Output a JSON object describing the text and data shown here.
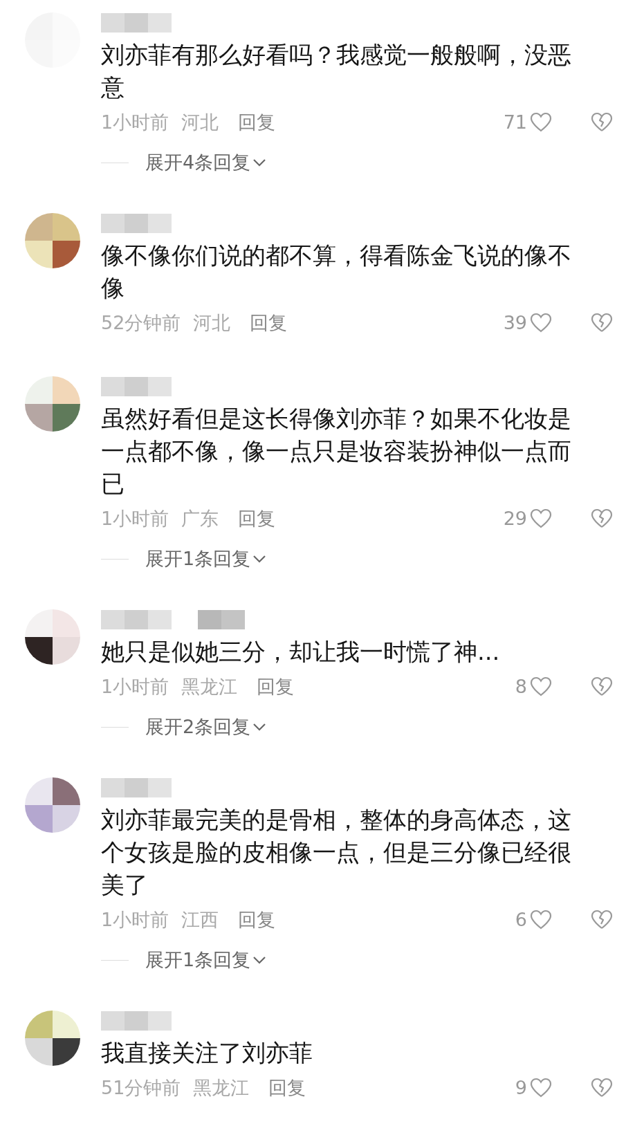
{
  "comments": [
    {
      "text": "刘亦菲有那么好看吗？我感觉一般般啊，没恶意",
      "time": "1小时前",
      "region": "河北",
      "reply": "回复",
      "likes": "71",
      "expand": "展开4条回复"
    },
    {
      "text": "像不像你们说的都不算，得看陈金飞说的像不像",
      "time": "52分钟前",
      "region": "河北",
      "reply": "回复",
      "likes": "39"
    },
    {
      "text": "虽然好看但是这长得像刘亦菲？如果不化妆是一点都不像，像一点只是妆容装扮神似一点而已",
      "time": "1小时前",
      "region": "广东",
      "reply": "回复",
      "likes": "29",
      "expand": "展开1条回复"
    },
    {
      "text": "她只是似她三分，却让我一时慌了神...",
      "time": "1小时前",
      "region": "黑龙江",
      "reply": "回复",
      "likes": "8",
      "expand": "展开2条回复"
    },
    {
      "text": "刘亦菲最完美的是骨相，整体的身高体态，这个女孩是脸的皮相像一点，但是三分像已经很美了",
      "time": "1小时前",
      "region": "江西",
      "reply": "回复",
      "likes": "6",
      "expand": "展开1条回复"
    },
    {
      "text": "我直接关注了刘亦菲",
      "time": "51分钟前",
      "region": "黑龙江",
      "reply": "回复",
      "likes": "9"
    }
  ]
}
